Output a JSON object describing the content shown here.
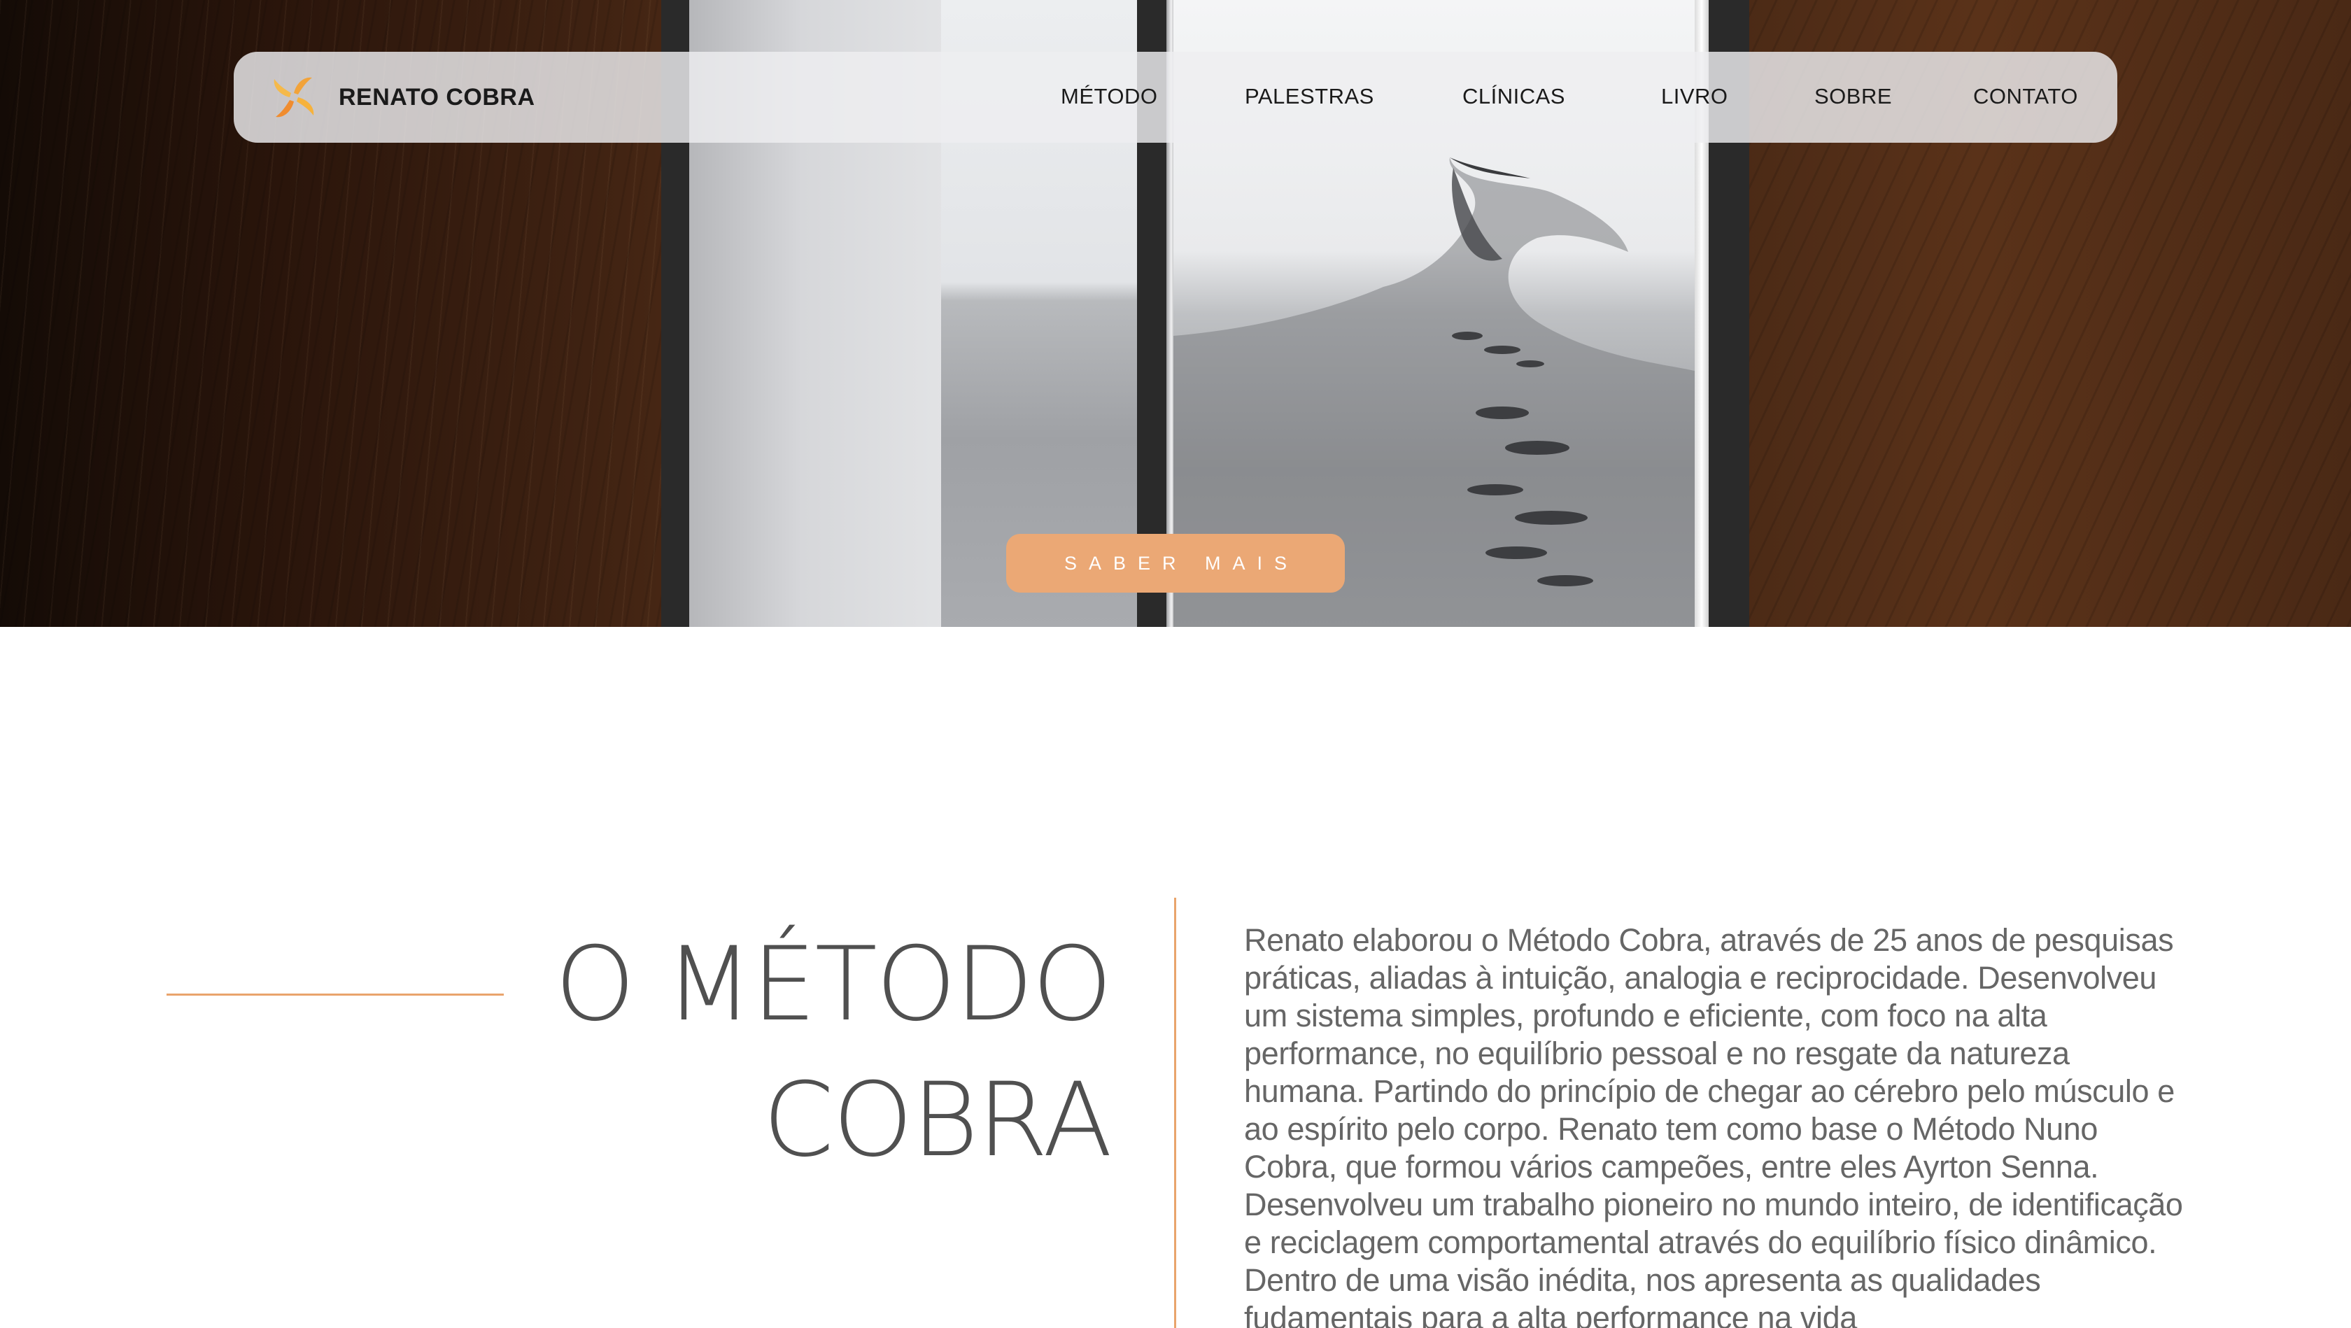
{
  "header": {
    "brand": "RENATO COBRA",
    "logo_icon": "swirl-logo-icon",
    "nav_items": [
      {
        "label": "MÉTODO"
      },
      {
        "label": "PALESTRAS"
      },
      {
        "label": "CLÍNICAS"
      },
      {
        "label": "LIVRO"
      },
      {
        "label": "SOBRE"
      },
      {
        "label": "CONTATO"
      }
    ]
  },
  "hero": {
    "cta_label": "SABER MAIS",
    "cta_color": "#eba875"
  },
  "section": {
    "title_line1": "O MÉTODO",
    "title_line2": "COBRA",
    "accent_color": "#e9a46c",
    "body": "Renato elaborou o Método Cobra, através de 25 anos de pesquisas práticas, aliadas à intuição, analogia e reciprocidade. Desenvolveu um sistema simples, profundo e eficiente, com foco na alta performance, no equilíbrio pessoal e no resgate da natureza humana. Partindo do princípio de chegar ao cérebro pelo músculo e ao espírito pelo corpo. Renato tem como base o Método Nuno Cobra, que formou vários campeões, entre eles Ayrton Senna. Desenvolveu um trabalho pioneiro no mundo inteiro, de identificação e reciclagem comportamental através do equilíbrio físico dinâmico. Dentro de uma visão inédita, nos apresenta as qualidades fudamentais para a alta performance na vida"
  }
}
